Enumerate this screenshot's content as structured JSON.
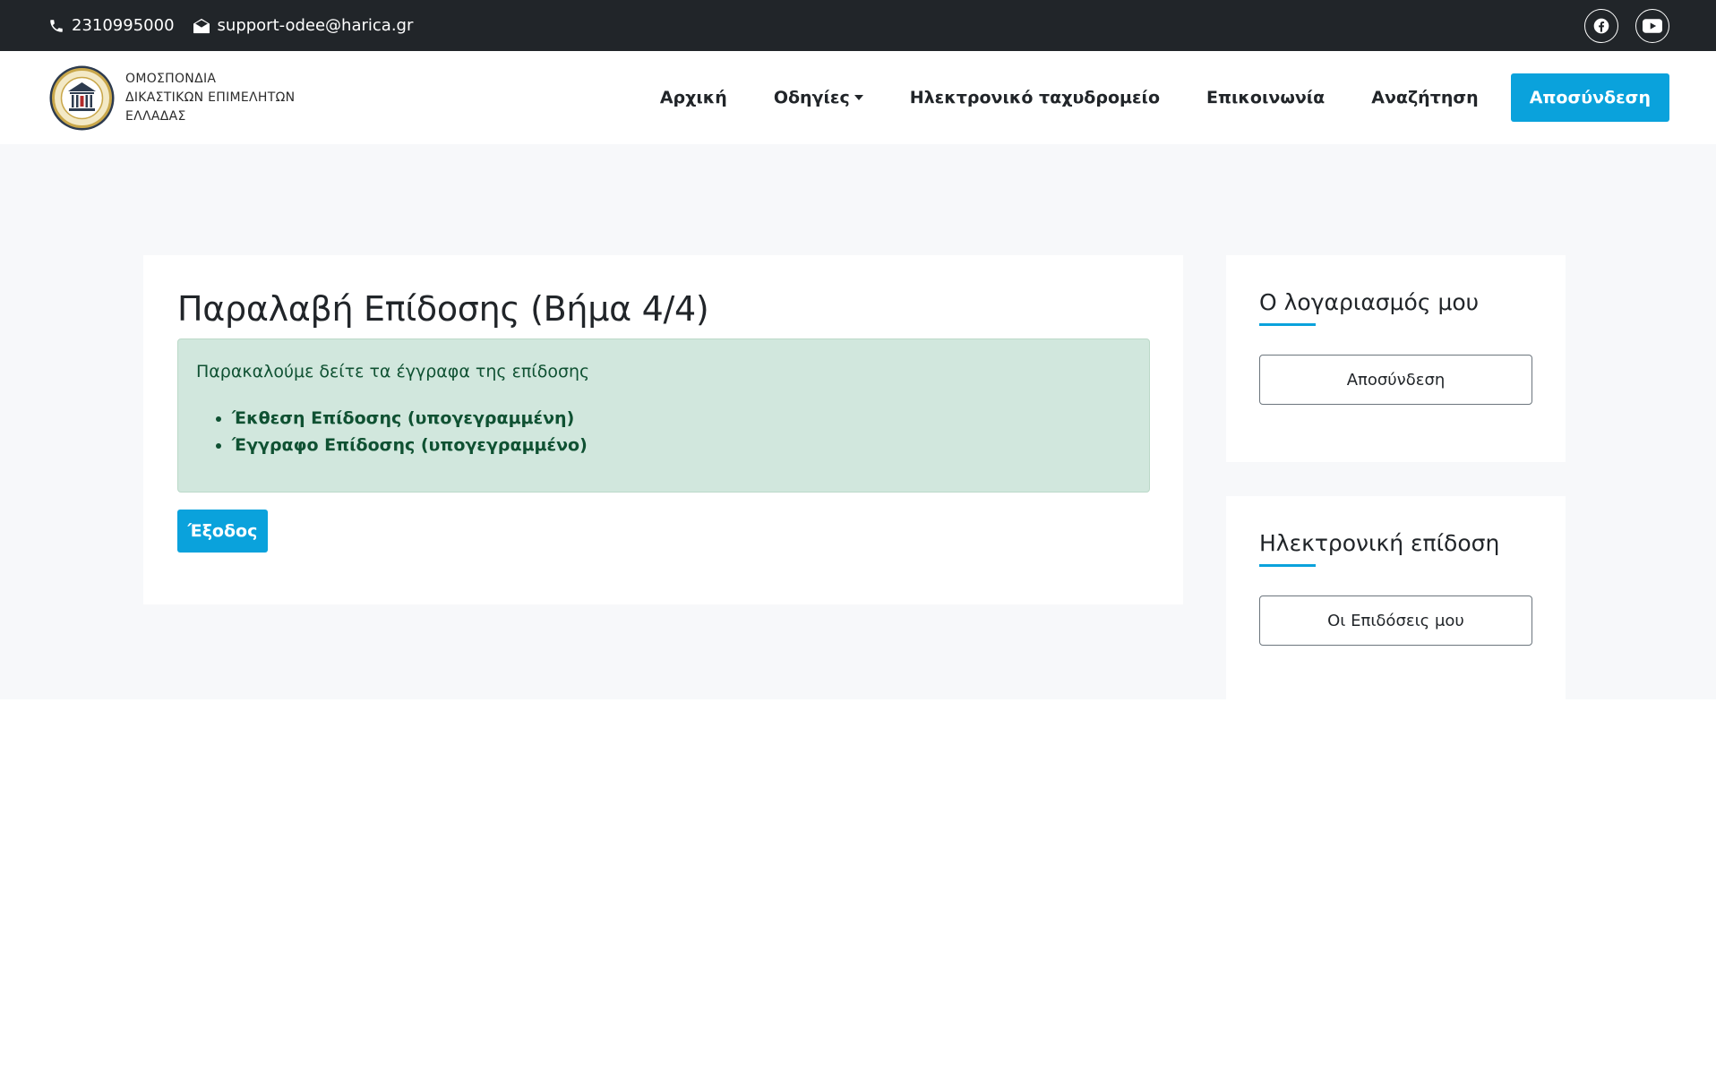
{
  "topbar": {
    "phone": "2310995000",
    "email": "support-odee@harica.gr",
    "social": [
      "facebook-icon",
      "youtube-icon"
    ],
    "background": "#212529"
  },
  "brand": {
    "line1": "ΟΜΟΣΠΟΝΔΙΑ",
    "line2": "ΔΙΚΑΣΤΙΚΩΝ ΕΠΙΜΕΛΗΤΩΝ",
    "line3": "ΕΛΛΑΔΑΣ"
  },
  "nav": {
    "home": "Αρχική",
    "guides": "Οδηγίες",
    "mail": "Ηλεκτρονικό ταχυδρομείο",
    "contact": "Επικοινωνία",
    "search": "Αναζήτηση",
    "logout": "Αποσύνδεση"
  },
  "main": {
    "title": "Παραλαβή Επίδοσης (Βήμα 4/4)",
    "alert_intro": "Παρακαλούμε δείτε τα έγγραφα της επίδοσης",
    "documents": [
      "Έκθεση Επίδοσης (υπογεγραμμένη)",
      "Έγγραφο Επίδοσης (υπογεγραμμένο)"
    ],
    "exit_label": "Έξοδος"
  },
  "sidebar": {
    "account_title": "Ο λογαριασμός μου",
    "account_button": "Αποσύνδεση",
    "service_title": "Ηλεκτρονική επίδοση",
    "service_button": "Οι Επιδόσεις μου"
  },
  "colors": {
    "accent": "#0aa2dc",
    "alert_bg": "#d1e7dd",
    "alert_text": "#0f5132"
  }
}
